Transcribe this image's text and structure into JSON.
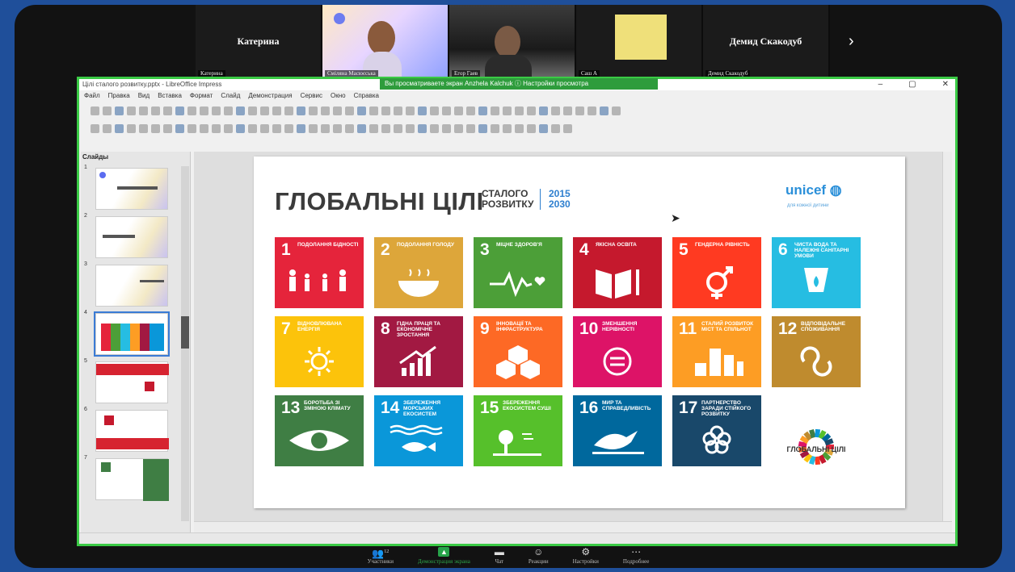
{
  "participants": {
    "tiles": [
      {
        "big_name": "Катерина",
        "tag": "Катерина"
      },
      {
        "big_name": "",
        "tag": "Сміляна Масюєська"
      },
      {
        "big_name": "",
        "tag": "Егор Гаев"
      },
      {
        "big_name": "",
        "tag": "Саш А"
      },
      {
        "big_name": "Демид Скакодуб",
        "tag": "Демид Скакодуб"
      }
    ],
    "next_icon": "chevron-right-icon"
  },
  "window": {
    "title": "Цілі сталого розвитку.pptx - LibreOffice Impress",
    "share_banner": "Вы просматриваете экран Anzhela Kalchuk ⓘ Настройки просмотра",
    "controls": [
      "–",
      "▢",
      "✕"
    ],
    "menu": [
      "Файл",
      "Правка",
      "Вид",
      "Вставка",
      "Формат",
      "Слайд",
      "Демонстрация",
      "Сервис",
      "Окно",
      "Справка"
    ]
  },
  "slides_panel": {
    "title": "Слайды",
    "slides": [
      {
        "num": "1"
      },
      {
        "num": "2"
      },
      {
        "num": "3"
      },
      {
        "num": "4"
      },
      {
        "num": "5"
      },
      {
        "num": "6"
      },
      {
        "num": "7"
      }
    ]
  },
  "slide": {
    "title": "ГЛОБАЛЬНІ ЦІЛІ",
    "subtitle_1": "СТАЛОГО",
    "subtitle_2": "РОЗВИТКУ",
    "year_1": "2015",
    "year_2": "2030",
    "unicef": "unicef",
    "unicef_tag": "для кожної дитини",
    "goals": [
      {
        "num": "1",
        "text": "ПОДОЛАННЯ БІДНОСТІ",
        "color": "#e5243b"
      },
      {
        "num": "2",
        "text": "ПОДОЛАННЯ ГОЛОДУ",
        "color": "#dda63a"
      },
      {
        "num": "3",
        "text": "МІЦНЕ ЗДОРОВ'Я",
        "color": "#4c9f38"
      },
      {
        "num": "4",
        "text": "ЯКІСНА ОСВІТА",
        "color": "#c5192d"
      },
      {
        "num": "5",
        "text": "ГЕНДЕРНА РІВНІСТЬ",
        "color": "#ff3a21"
      },
      {
        "num": "6",
        "text": "ЧИСТА ВОДА ТА НАЛЕЖНІ САНІТАРНІ УМОВИ",
        "color": "#26bde2"
      },
      {
        "num": "7",
        "text": "ВІДНОВЛЮВАНА ЕНЕРГІЯ",
        "color": "#fcc30b"
      },
      {
        "num": "8",
        "text": "ГІДНА ПРАЦЯ ТА ЕКОНОМІЧНЕ ЗРОСТАННЯ",
        "color": "#a21942"
      },
      {
        "num": "9",
        "text": "ІННОВАЦІЇ ТА ІНФРАСТРУКТУРА",
        "color": "#fd6925"
      },
      {
        "num": "10",
        "text": "ЗМЕНШЕННЯ НЕРІВНОСТІ",
        "color": "#dd1367"
      },
      {
        "num": "11",
        "text": "СТАЛИЙ РОЗВИТОК МІСТ ТА СПІЛЬНОТ",
        "color": "#fd9d24"
      },
      {
        "num": "12",
        "text": "ВІДПОВІДАЛЬНЕ СПОЖИВАННЯ",
        "color": "#bf8b2e"
      },
      {
        "num": "13",
        "text": "БОРОТЬБА ЗІ ЗМІНОЮ КЛІМАТУ",
        "color": "#3f7e44"
      },
      {
        "num": "14",
        "text": "ЗБЕРЕЖЕННЯ МОРСЬКИХ ЕКОСИСТЕМ",
        "color": "#0a97d9"
      },
      {
        "num": "15",
        "text": "ЗБЕРЕЖЕННЯ ЕКОСИСТЕМ СУШІ",
        "color": "#56c02b"
      },
      {
        "num": "16",
        "text": "МИР ТА СПРАВЕДЛИВІСТЬ",
        "color": "#00689d"
      },
      {
        "num": "17",
        "text": "ПАРТНЕРСТВО ЗАРАДИ СТІЙКОГО РОЗВИТКУ",
        "color": "#19486a"
      },
      {
        "num": "",
        "text": "ГЛОБАЛЬНІ ЦІЛІ",
        "color": "#ffffff"
      }
    ]
  },
  "zoom_bar": {
    "participants_count": "12",
    "items": [
      {
        "label": "Участники",
        "icon": "participants-icon"
      },
      {
        "label": "Демонстрация экрана",
        "icon": "share-screen-icon"
      },
      {
        "label": "Чат",
        "icon": "chat-icon"
      },
      {
        "label": "Реакции",
        "icon": "reactions-icon"
      },
      {
        "label": "Настройки",
        "icon": "settings-icon"
      },
      {
        "label": "Подробнее",
        "icon": "more-icon"
      }
    ]
  }
}
